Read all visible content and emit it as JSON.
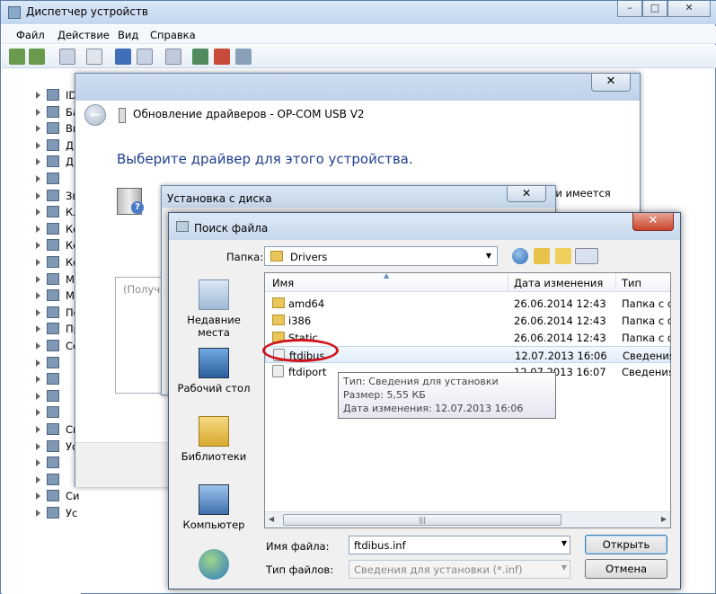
{
  "device_manager": {
    "title": "Диспетчер устройств",
    "menu": [
      "Файл",
      "Действие",
      "Вид",
      "Справка"
    ],
    "tree_labels": [
      "ID",
      "Ба",
      "Ви",
      "Ди",
      "Др",
      "",
      "Зв",
      "Кл",
      "Ко",
      "Ко",
      "Ко",
      "Ми",
      "Мы",
      "По",
      "Пр",
      "Се",
      "",
      "",
      "",
      "",
      "Си",
      "Ус",
      "",
      "",
      "Си",
      "Ус"
    ]
  },
  "update_wizard": {
    "title": "Обновление драйверов - OP-COM USB V2",
    "heading": "Выберите драйвер для этого устройства.",
    "text_fragment": "ли имеется",
    "list_placeholder": "(Получе"
  },
  "install_from_disk": {
    "title": "Установка с диска"
  },
  "file_dialog": {
    "title": "Поиск файла",
    "folder_label": "Папка:",
    "folder_value": "Drivers",
    "places": [
      "Недавние места",
      "Рабочий стол",
      "Библиотеки",
      "Компьютер",
      ""
    ],
    "columns": [
      "Имя",
      "Дата изменения",
      "Тип"
    ],
    "files": [
      {
        "name": "amd64",
        "date": "26.06.2014 12:43",
        "type": "Папка с ф",
        "kind": "folder"
      },
      {
        "name": "i386",
        "date": "26.06.2014 12:43",
        "type": "Папка с ф",
        "kind": "folder"
      },
      {
        "name": "Static",
        "date": "26.06.2014 12:43",
        "type": "Папка с ф",
        "kind": "folder"
      },
      {
        "name": "ftdibus",
        "date": "12.07.2013 16:06",
        "type": "Сведения",
        "kind": "inf"
      },
      {
        "name": "ftdiport",
        "date": "12.07.2013 16:07",
        "type": "Сведения",
        "kind": "inf"
      }
    ],
    "tooltip": {
      "type": "Тип: Сведения для установки",
      "size": "Размер: 5,55 КБ",
      "modified": "Дата изменения: 12.07.2013 16:06"
    },
    "filename_label": "Имя файла:",
    "filename_value": "ftdibus.inf",
    "filetype_label": "Тип файлов:",
    "filetype_value": "Сведения для установки (*.inf)",
    "open_button": "Открыть",
    "cancel_button": "Отмена"
  },
  "colors": {
    "heading_blue": "#1f3f8f",
    "highlight_ring": "#d0141c",
    "close_red": "#c8462e"
  }
}
